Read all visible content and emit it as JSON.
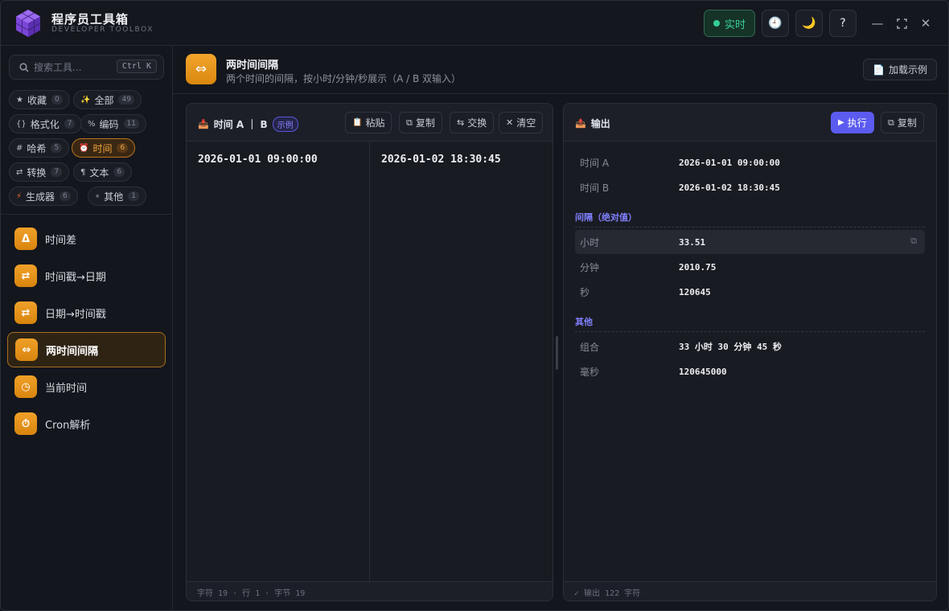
{
  "app": {
    "title": "程序员工具箱",
    "subtitle": "DEVELOPER TOOLBOX"
  },
  "topbar": {
    "live_label": "实时",
    "history_icon": "clock-icon",
    "theme_icon": "moon-icon",
    "help_label": "?"
  },
  "sidebar": {
    "search": {
      "placeholder": "搜索工具...",
      "shortcut": "Ctrl K"
    },
    "categories": [
      {
        "icon": "★",
        "label": "收藏",
        "count": "0"
      },
      {
        "icon": "✨",
        "label": "全部",
        "count": "49"
      },
      {
        "icon": "{}",
        "label": "格式化",
        "count": "7"
      },
      {
        "icon": "%",
        "label": "编码",
        "count": "11"
      },
      {
        "icon": "#",
        "label": "哈希",
        "count": "5"
      },
      {
        "icon": "⏰",
        "label": "时间",
        "count": "6"
      },
      {
        "icon": "⇄",
        "label": "转换",
        "count": "7"
      },
      {
        "icon": "¶",
        "label": "文本",
        "count": "6"
      },
      {
        "icon": "⚡",
        "label": "生成器",
        "count": "6"
      },
      {
        "icon": "∘",
        "label": "其他",
        "count": "1"
      }
    ],
    "items": [
      {
        "icon": "Δ",
        "label": "时间差"
      },
      {
        "icon": "⇄",
        "label": "时间戳→日期"
      },
      {
        "icon": "⇄",
        "label": "日期→时间戳"
      },
      {
        "icon": "⇔",
        "label": "两时间间隔"
      },
      {
        "icon": "◷",
        "label": "当前时间"
      },
      {
        "icon": "⏱",
        "label": "Cron解析"
      }
    ]
  },
  "header": {
    "icon": "⇔",
    "title": "两时间间隔",
    "description": "两个时间的间隔，按小时/分钟/秒展示（A / B 双输入）",
    "load_example": "加载示例"
  },
  "input_panel": {
    "title": "时间 A ｜ B",
    "badge": "示例",
    "buttons": {
      "paste": "粘贴",
      "copy": "复制",
      "swap": "交换",
      "clear": "清空"
    },
    "value_a": "2026-01-01 09:00:00",
    "value_b": "2026-01-02 18:30:45",
    "footer": "字符 19 · 行 1 · 字节 19"
  },
  "output_panel": {
    "title": "输出",
    "buttons": {
      "run": "执行",
      "copy": "复制"
    },
    "rows_top": [
      {
        "key": "时间 A",
        "value": "2026-01-01 09:00:00"
      },
      {
        "key": "时间 B",
        "value": "2026-01-02 18:30:45"
      }
    ],
    "section_interval": "间隔（绝对值）",
    "rows_interval": [
      {
        "key": "小时",
        "value": "33.51"
      },
      {
        "key": "分钟",
        "value": "2010.75"
      },
      {
        "key": "秒",
        "value": "120645"
      }
    ],
    "section_other": "其他",
    "rows_other": [
      {
        "key": "组合",
        "value": "33 小时 30 分钟 45 秒"
      },
      {
        "key": "毫秒",
        "value": "120645000"
      }
    ],
    "footer": "✓ 输出 122 字符"
  }
}
